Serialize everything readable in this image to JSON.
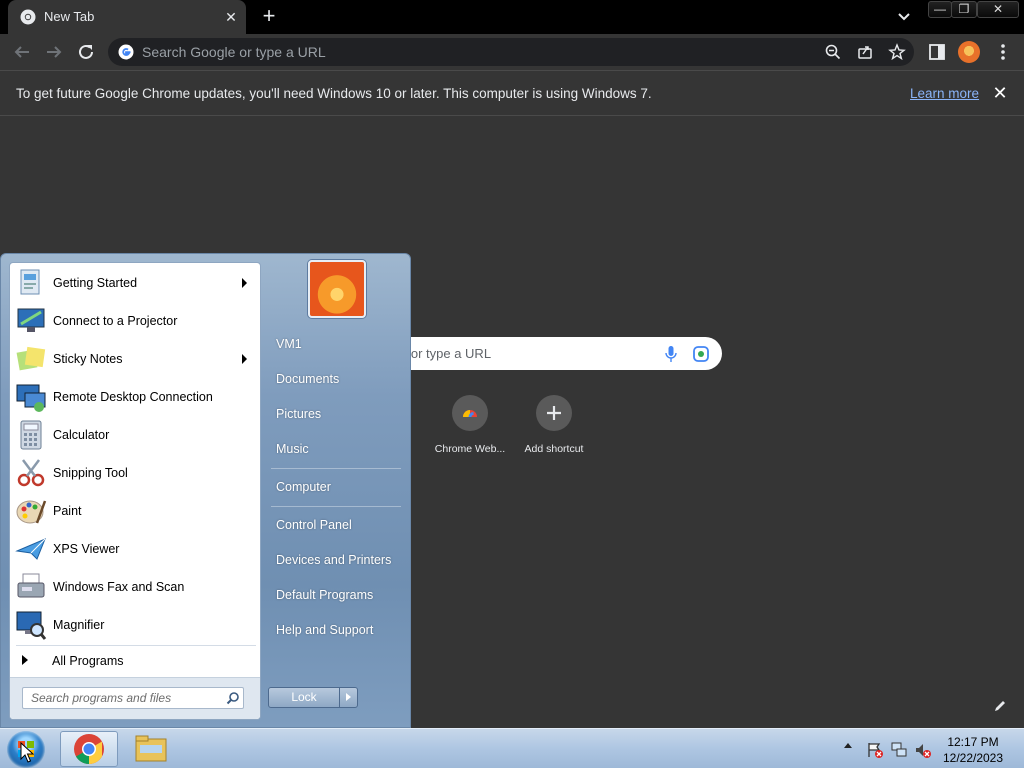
{
  "browser": {
    "tab": {
      "title": "New Tab",
      "close": "✕"
    },
    "new_tab": "+",
    "window_controls": {
      "min": "—",
      "max": "❐",
      "close": "✕"
    },
    "omnibox": {
      "placeholder": "Search Google or type a URL"
    },
    "infobar": {
      "message": "To get future Google Chrome updates, you'll need Windows 10 or later. This computer is using Windows 7.",
      "link": "Learn more",
      "close": "✕"
    }
  },
  "ntp": {
    "search_visible_text": "e or type a URL",
    "shortcuts": [
      {
        "label": "Chrome Web...",
        "icon": "chrome-web-store-icon"
      },
      {
        "label": "Add shortcut",
        "icon": "plus-icon"
      }
    ]
  },
  "start_menu": {
    "programs": [
      {
        "label": "Getting Started",
        "icon": "getting-started-icon",
        "submenu": true
      },
      {
        "label": "Connect to a Projector",
        "icon": "projector-icon",
        "submenu": false
      },
      {
        "label": "Sticky Notes",
        "icon": "sticky-notes-icon",
        "submenu": true
      },
      {
        "label": "Remote Desktop Connection",
        "icon": "remote-desktop-icon",
        "submenu": false
      },
      {
        "label": "Calculator",
        "icon": "calculator-icon",
        "submenu": false
      },
      {
        "label": "Snipping Tool",
        "icon": "scissors-icon",
        "submenu": false
      },
      {
        "label": "Paint",
        "icon": "paint-icon",
        "submenu": false
      },
      {
        "label": "XPS Viewer",
        "icon": "xps-viewer-icon",
        "submenu": false
      },
      {
        "label": "Windows Fax and Scan",
        "icon": "fax-icon",
        "submenu": false
      },
      {
        "label": "Magnifier",
        "icon": "magnifier-icon",
        "submenu": false
      }
    ],
    "all_programs": "All Programs",
    "search_placeholder": "Search programs and files",
    "right_links": [
      "VM1",
      "Documents",
      "Pictures",
      "Music",
      "Computer",
      "Control Panel",
      "Devices and Printers",
      "Default Programs",
      "Help and Support"
    ],
    "lock": "Lock"
  },
  "taskbar": {
    "clock_time": "12:17 PM",
    "clock_date": "12/22/2023"
  },
  "colors": {
    "chrome_dark": "#353535",
    "link_blue": "#8ab4f8",
    "startmenu_blue": "#7f9cbd",
    "taskbar_blue": "#aec6e2"
  }
}
